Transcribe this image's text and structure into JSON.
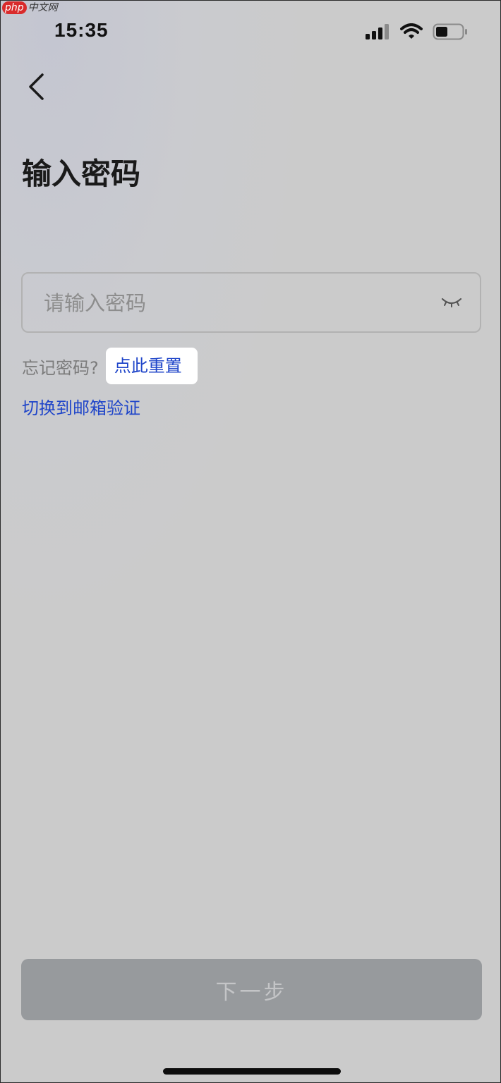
{
  "watermark": {
    "logo": "php",
    "site": "中文网"
  },
  "status_bar": {
    "time": "15:35",
    "icons": [
      "signal-icon",
      "wifi-icon",
      "battery-icon"
    ],
    "battery_level": 0.45
  },
  "nav": {
    "back_icon": "chevron-left-icon"
  },
  "page": {
    "title": "输入密码"
  },
  "password_field": {
    "placeholder": "请输入密码",
    "value": "",
    "visibility_icon": "eye-closed-icon"
  },
  "forgot": {
    "prompt": "忘记密码?",
    "reset_link": "点此重置"
  },
  "switch_email_link": "切换到邮箱验证",
  "next_button": {
    "label": "下一步",
    "disabled": true
  },
  "colors": {
    "background": "#cbcbcb",
    "link": "#1f45c9",
    "button_disabled_bg": "#979a9d",
    "button_disabled_text": "#c4c5c7"
  }
}
